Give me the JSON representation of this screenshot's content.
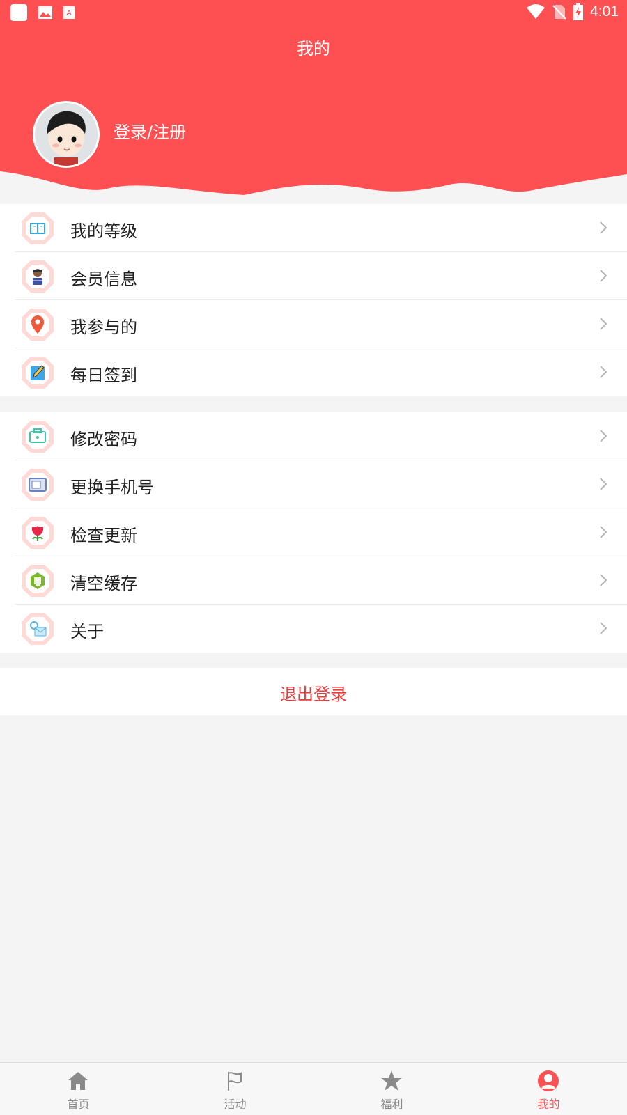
{
  "status_bar": {
    "time": "4:01"
  },
  "header": {
    "title": "我的",
    "login_label": "登录/注册"
  },
  "menu_group_1": [
    {
      "label": "我的等级",
      "icon": "level-book-icon"
    },
    {
      "label": "会员信息",
      "icon": "member-icon"
    },
    {
      "label": "我参与的",
      "icon": "location-pin-icon"
    },
    {
      "label": "每日签到",
      "icon": "checkin-pencil-icon"
    }
  ],
  "menu_group_2": [
    {
      "label": "修改密码",
      "icon": "password-icon"
    },
    {
      "label": "更换手机号",
      "icon": "phone-card-icon"
    },
    {
      "label": "检查更新",
      "icon": "update-flower-icon"
    },
    {
      "label": "清空缓存",
      "icon": "clear-cache-icon"
    },
    {
      "label": "关于",
      "icon": "about-mail-icon"
    }
  ],
  "logout_label": "退出登录",
  "tab_bar": {
    "tabs": [
      {
        "label": "首页",
        "icon": "home-icon",
        "active": false
      },
      {
        "label": "活动",
        "icon": "flag-icon",
        "active": false
      },
      {
        "label": "福利",
        "icon": "star-icon",
        "active": false
      },
      {
        "label": "我的",
        "icon": "user-icon",
        "active": true
      }
    ]
  },
  "colors": {
    "brand": "#fe5052",
    "logout": "#ef3b3b",
    "tab_inactive": "#8a8a8a"
  }
}
